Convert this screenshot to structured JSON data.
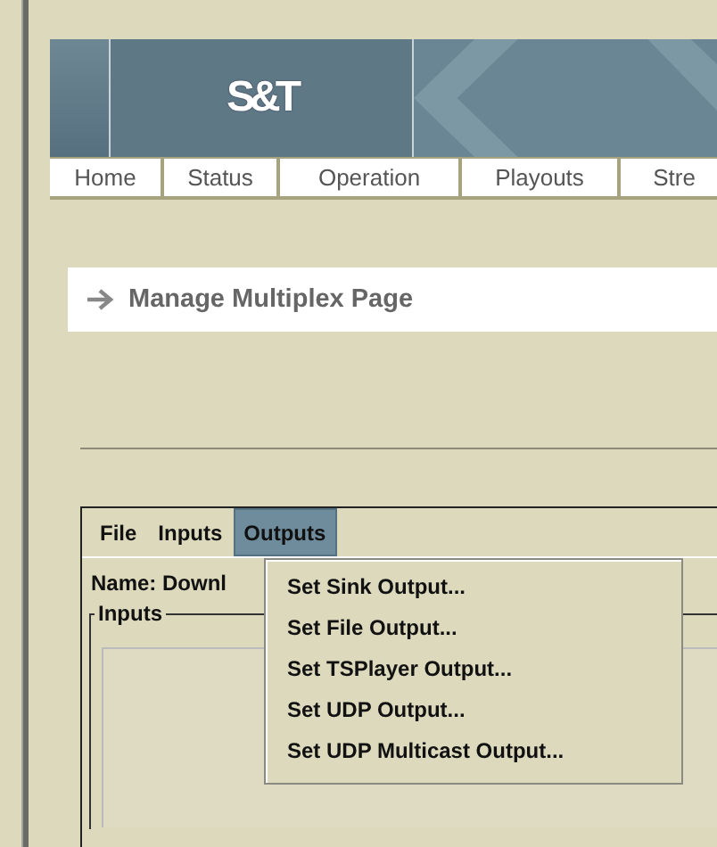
{
  "banner": {
    "logo": "S&T"
  },
  "nav": [
    {
      "label": "Home"
    },
    {
      "label": "Status"
    },
    {
      "label": "Operation"
    },
    {
      "label": "Playouts"
    },
    {
      "label": "Stre"
    }
  ],
  "page_title": "Manage Multiplex Page",
  "applet": {
    "menubar": [
      {
        "label": "File",
        "selected": false
      },
      {
        "label": "Inputs",
        "selected": false
      },
      {
        "label": "Outputs",
        "selected": true
      }
    ],
    "name_label": "Name: Downl",
    "inputs_group": "Inputs",
    "menu": [
      {
        "label": "Set Sink Output..."
      },
      {
        "label": "Set File Output..."
      },
      {
        "label": "Set TSPlayer Output..."
      },
      {
        "label": "Set UDP Output..."
      },
      {
        "label": "Set UDP Multicast Output..."
      }
    ]
  }
}
